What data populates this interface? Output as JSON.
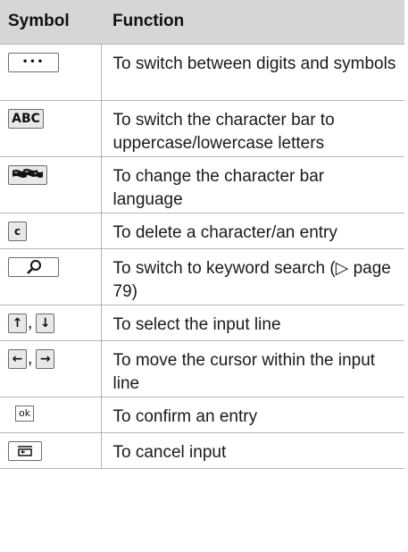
{
  "header": {
    "symbol": "Symbol",
    "function": "Function"
  },
  "rows": [
    {
      "keys": [
        "•••"
      ],
      "separator": "",
      "function": "To switch between digits and symbols"
    },
    {
      "keys": [
        "ABC"
      ],
      "separator": "",
      "function": "To switch the character bar to uppercase/lowercase letters"
    },
    {
      "keys": [
        "flags-icon"
      ],
      "separator": "",
      "function": "To change the character bar language"
    },
    {
      "keys": [
        "c"
      ],
      "separator": "",
      "function": "To delete a character/an entry"
    },
    {
      "keys": [
        "search-icon"
      ],
      "separator": "",
      "function": "To switch to keyword search (▷ page 79)"
    },
    {
      "keys": [
        "↑",
        "↓"
      ],
      "separator": ",",
      "function": "To select the input line"
    },
    {
      "keys": [
        "←",
        "→"
      ],
      "separator": ",",
      "function": "To move the cursor within the input line"
    },
    {
      "keys": [
        "ok"
      ],
      "separator": "",
      "function": "To confirm an entry"
    },
    {
      "keys": [
        "back-icon"
      ],
      "separator": "",
      "function": "To cancel input"
    }
  ]
}
